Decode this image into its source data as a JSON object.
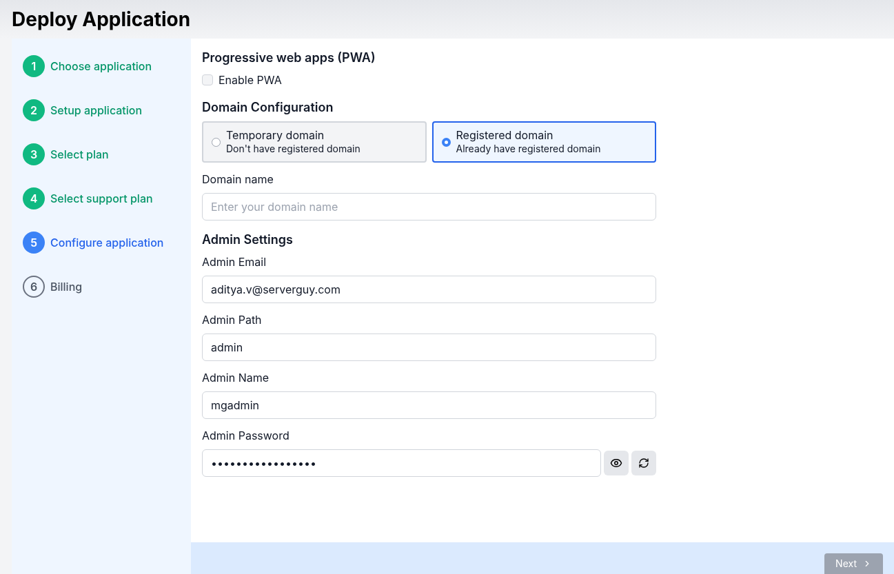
{
  "title": "Deploy Application",
  "steps": [
    {
      "number": "1",
      "label": "Choose application",
      "kind": "done"
    },
    {
      "number": "2",
      "label": "Setup application",
      "kind": "done"
    },
    {
      "number": "3",
      "label": "Select plan",
      "kind": "done"
    },
    {
      "number": "4",
      "label": "Select support plan",
      "kind": "done"
    },
    {
      "number": "5",
      "label": "Configure application",
      "kind": "current"
    },
    {
      "number": "6",
      "label": "Billing",
      "kind": "pending"
    }
  ],
  "pwa": {
    "heading": "Progressive web apps (PWA)",
    "checkbox": {
      "label": "Enable PWA",
      "checked": false
    }
  },
  "domain": {
    "heading": "Domain Configuration",
    "options": [
      {
        "title": "Temporary domain",
        "subtitle": "Don't have registered domain",
        "selected": false
      },
      {
        "title": "Registered domain",
        "subtitle": "Already have registered domain",
        "selected": true
      }
    ],
    "field": {
      "label": "Domain name",
      "placeholder": "Enter your domain name"
    }
  },
  "admin": {
    "heading": "Admin Settings",
    "fields": [
      {
        "label": "Admin Email",
        "value": "aditya.v@serverguy.com"
      },
      {
        "label": "Admin Path",
        "value": "admin"
      },
      {
        "label": "Admin Name",
        "value": "mgadmin"
      }
    ],
    "password": {
      "label": "Admin Password",
      "value": "•••••••••••••••••"
    }
  },
  "next_button": {
    "label": "Next",
    "disabled": true
  }
}
